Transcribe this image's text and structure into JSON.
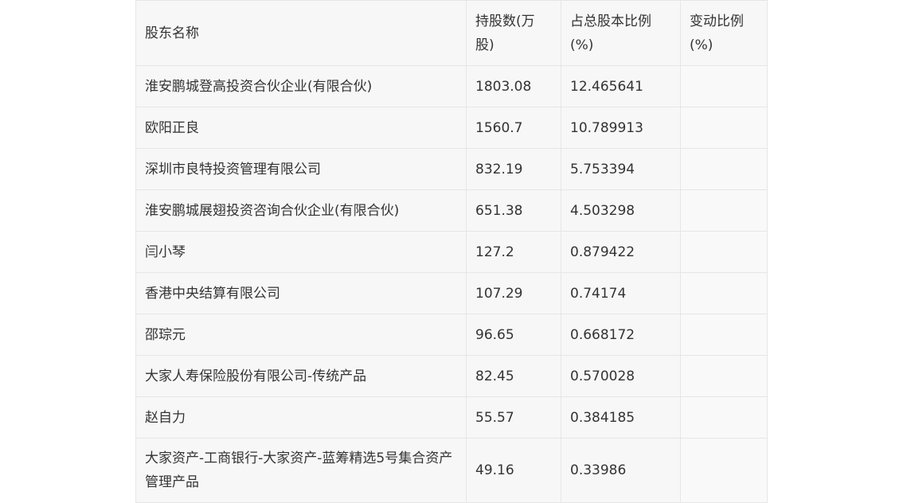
{
  "table": {
    "headers": [
      "股东名称",
      "持股数(万股)",
      "占总股本比例(%)",
      "变动比例(%)"
    ],
    "rows": [
      {
        "name": "淮安鹏城登高投资合伙企业(有限合伙)",
        "shares": "1803.08",
        "ratio": "12.465641",
        "change": ""
      },
      {
        "name": "欧阳正良",
        "shares": "1560.7",
        "ratio": "10.789913",
        "change": ""
      },
      {
        "name": "深圳市良特投资管理有限公司",
        "shares": "832.19",
        "ratio": "5.753394",
        "change": ""
      },
      {
        "name": "淮安鹏城展翅投资咨询合伙企业(有限合伙)",
        "shares": "651.38",
        "ratio": "4.503298",
        "change": ""
      },
      {
        "name": "闫小琴",
        "shares": "127.2",
        "ratio": "0.879422",
        "change": ""
      },
      {
        "name": "香港中央结算有限公司",
        "shares": "107.29",
        "ratio": "0.74174",
        "change": ""
      },
      {
        "name": "邵琮元",
        "shares": "96.65",
        "ratio": "0.668172",
        "change": ""
      },
      {
        "name": "大家人寿保险股份有限公司-传统产品",
        "shares": "82.45",
        "ratio": "0.570028",
        "change": ""
      },
      {
        "name": "赵自力",
        "shares": "55.57",
        "ratio": "0.384185",
        "change": ""
      },
      {
        "name": "大家资产-工商银行-大家资产-蓝筹精选5号集合资产管理产品",
        "shares": "49.16",
        "ratio": "0.33986",
        "change": ""
      }
    ]
  }
}
